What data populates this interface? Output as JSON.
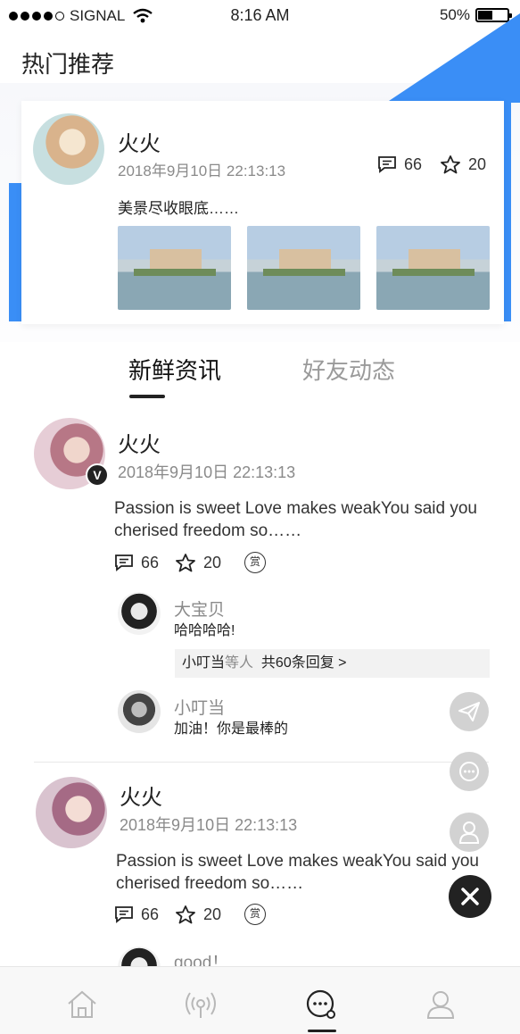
{
  "status_bar": {
    "carrier": "SIGNAL",
    "time": "8:16 AM",
    "battery_text": "50%",
    "battery_level": 0.5
  },
  "header": {
    "title": "热门推荐"
  },
  "hot_card": {
    "name": "火火",
    "date": "2018年9月10日  22:13:13",
    "comments": "66",
    "likes": "20",
    "text": "美景尽收眼底……"
  },
  "tabs": {
    "active": "新鲜资讯",
    "inactive": "好友动态"
  },
  "posts": [
    {
      "name": "火火",
      "date": "2018年9月10日  22:13:13",
      "text": "Passion is sweet   Love makes weakYou said you cherised freedom so……",
      "comments": "66",
      "likes": "20",
      "reward": "赏",
      "badge": "V",
      "comments_list": [
        {
          "name": "大宝贝",
          "text": "哈哈哈哈!"
        },
        {
          "name": "小叮当",
          "text": "加油！你是最棒的"
        }
      ],
      "reply_summary": {
        "who": "小叮当",
        "etc": "等人",
        "count": "共60条回复 >"
      }
    },
    {
      "name": "火火",
      "date": "2018年9月10日  22:13:13",
      "text": "Passion is sweet   Love makes weakYou said you cherised freedom so……",
      "comments": "66",
      "likes": "20",
      "reward": "赏",
      "comments_list": [
        {
          "name": "good！"
        }
      ]
    }
  ],
  "icons": {
    "fab": [
      "send-icon",
      "chat-icon",
      "user-icon",
      "close-icon"
    ],
    "nav": [
      "home-icon",
      "radio-icon",
      "message-icon",
      "profile-icon"
    ]
  },
  "colors": {
    "accent": "#3a8ef6",
    "dark": "#222222",
    "muted": "#8a8a8a"
  }
}
